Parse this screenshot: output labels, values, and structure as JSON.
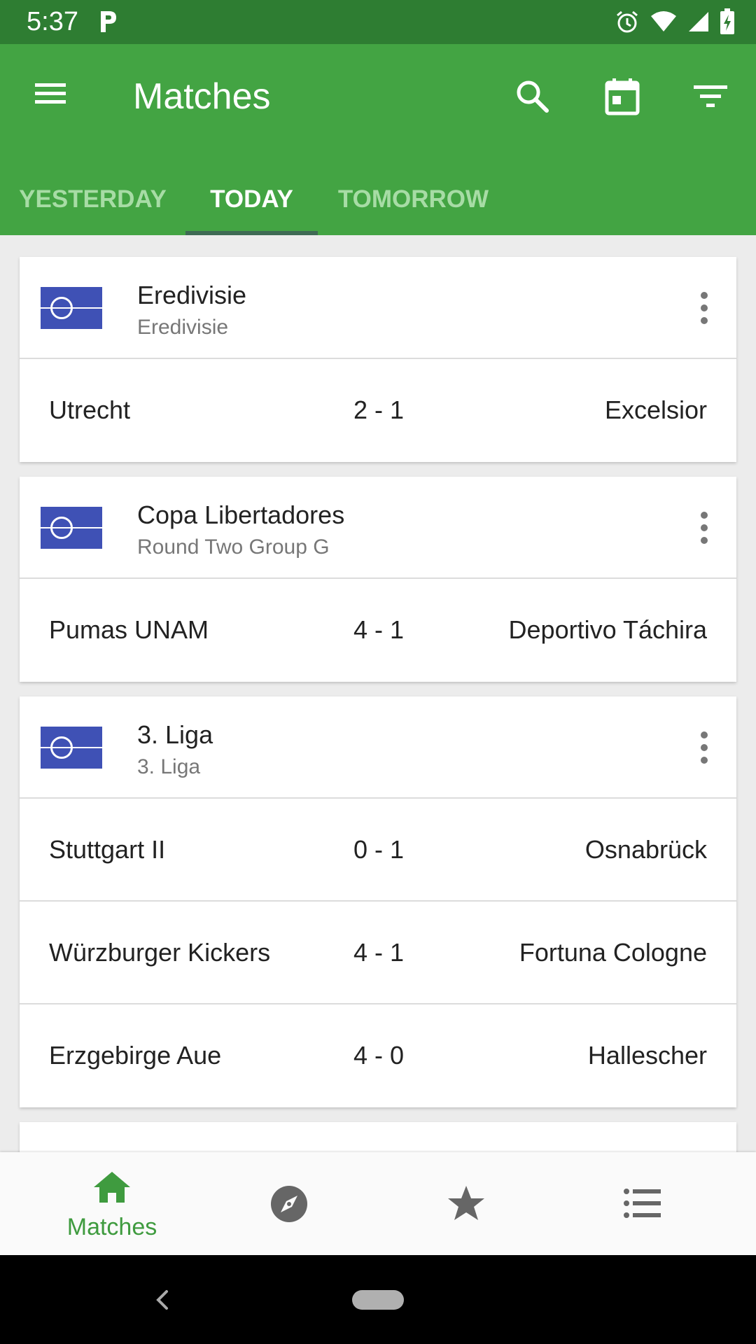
{
  "status_bar": {
    "time": "5:37"
  },
  "app_bar": {
    "title": "Matches"
  },
  "tabs": [
    {
      "label": "YESTERDAY"
    },
    {
      "label": "TODAY"
    },
    {
      "label": "TOMORROW"
    }
  ],
  "cards": [
    {
      "league": "Eredivisie",
      "subtitle": "Eredivisie",
      "matches": [
        {
          "home": "Utrecht",
          "score": "2 - 1",
          "away": "Excelsior"
        }
      ]
    },
    {
      "league": "Copa Libertadores",
      "subtitle": "Round Two Group G",
      "matches": [
        {
          "home": "Pumas UNAM",
          "score": "4 - 1",
          "away": "Deportivo Táchira"
        }
      ]
    },
    {
      "league": "3. Liga",
      "subtitle": "3. Liga",
      "matches": [
        {
          "home": "Stuttgart II",
          "score": "0 - 1",
          "away": "Osnabrück"
        },
        {
          "home": "Würzburger Kickers",
          "score": "4 - 1",
          "away": "Fortuna Cologne"
        },
        {
          "home": "Erzgebirge Aue",
          "score": "4 - 0",
          "away": "Hallescher"
        }
      ]
    }
  ],
  "bottom_nav": {
    "matches_label": "Matches"
  },
  "colors": {
    "primary": "#43a443",
    "status_bar": "#2e7d32",
    "flag": "#3f51b5",
    "active_nav": "#3f9b3f"
  },
  "icons": [
    "menu-icon",
    "search-icon",
    "calendar-icon",
    "filter-icon",
    "home-icon",
    "compass-icon",
    "star-icon",
    "list-icon"
  ]
}
